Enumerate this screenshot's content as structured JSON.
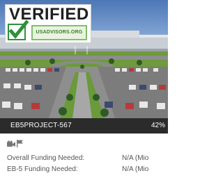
{
  "badge": {
    "title": "VERIFIED",
    "site": "USADVISORS.ORG"
  },
  "project": {
    "id": "EB5PROJECT-567",
    "percent": "42%"
  },
  "icons": [
    "video-camera-icon",
    "flag-icon"
  ],
  "details": [
    {
      "label": "Overall Funding Needed:",
      "value": "N/A (Mio"
    },
    {
      "label": "EB-5 Funding Needed:",
      "value": "N/A (Mio"
    }
  ],
  "colors": {
    "caption_bg": "#2b2b2b",
    "badge_green": "#2f8f3a",
    "text_gray": "#555555"
  }
}
